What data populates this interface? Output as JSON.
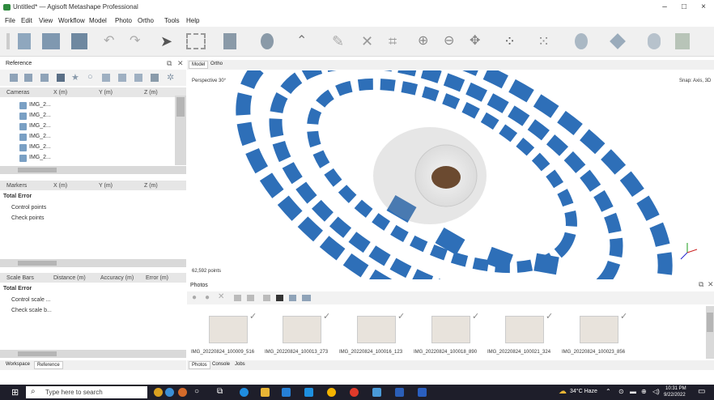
{
  "window": {
    "title": "Untitled* — Agisoft Metashape Professional",
    "minimize": "–",
    "maximize": "□",
    "close": "×"
  },
  "menu": [
    "File",
    "Edit",
    "View",
    "Workflow",
    "Model",
    "Photo",
    "Ortho",
    "Tools",
    "Help"
  ],
  "reference_panel": {
    "title": "Reference",
    "cameras_columns": [
      "Cameras",
      "X (m)",
      "Y (m)",
      "Z (m)"
    ],
    "cameras": [
      "IMG_2...",
      "IMG_2...",
      "IMG_2...",
      "IMG_2...",
      "IMG_2...",
      "IMG_2..."
    ],
    "markers_columns": [
      "Markers",
      "X (m)",
      "Y (m)",
      "Z (m)"
    ],
    "markers_rows": [
      "Total Error",
      "Control points",
      "Check points"
    ],
    "scalebars_columns": [
      "Scale Bars",
      "Distance (m)",
      "Accuracy (m)",
      "Error (m)"
    ],
    "scalebars_rows": [
      "Total Error",
      "Control scale ...",
      "Check scale b..."
    ]
  },
  "left_tabs": [
    "Workspace",
    "Reference"
  ],
  "view_tabs": [
    "Model",
    "Ortho"
  ],
  "viewport": {
    "mode": "Perspective 30°",
    "snap": "Snap: Axis, 3D",
    "points": "62,592 points"
  },
  "photos_panel": {
    "title": "Photos",
    "items": [
      "IMG_20220824_100009_516",
      "IMG_20220824_100013_273",
      "IMG_20220824_100016_123",
      "IMG_20220824_100018_890",
      "IMG_20220824_100021_324",
      "IMG_20220824_100023_856"
    ]
  },
  "bottom_tabs": [
    "Photos",
    "Console",
    "Jobs"
  ],
  "taskbar": {
    "search_placeholder": "Type here to search",
    "weather": "34°C Haze",
    "time": "10:31 PM",
    "date": "9/22/2022"
  },
  "colors": {
    "camera_blue": "#2e6fb8",
    "taskbar": "#1e1e2a"
  }
}
